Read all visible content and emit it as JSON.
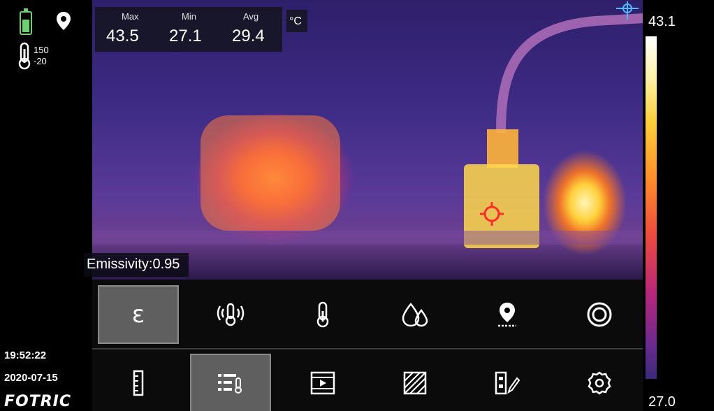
{
  "stats": {
    "max_label": "Max",
    "max_value": "43.5",
    "min_label": "Min",
    "min_value": "27.1",
    "avg_label": "Avg",
    "avg_value": "29.4",
    "unit": "°C"
  },
  "range": {
    "high": "150",
    "low": "-20"
  },
  "emissivity": "Emissivity:0.95",
  "scale": {
    "max": "43.1",
    "min": "27.0"
  },
  "time": "19:52:22",
  "date": "2020-07-15",
  "brand": "FOTRIC",
  "colors": {
    "battery": "#6fd06f",
    "crosshair": "#ff2a2a",
    "selected_bg": "#5f5f5f",
    "spot_marker": "#4fb8ff"
  },
  "toolbar_top": [
    {
      "icon": "epsilon-icon",
      "label": "ε",
      "selected": true
    },
    {
      "icon": "thermometer-signal-icon",
      "selected": false
    },
    {
      "icon": "thermometer-icon",
      "selected": false
    },
    {
      "icon": "water-drops-icon",
      "selected": false
    },
    {
      "icon": "location-pin-icon",
      "selected": false
    },
    {
      "icon": "target-circle-icon",
      "selected": false
    }
  ],
  "toolbar_bottom": [
    {
      "icon": "ruler-icon",
      "selected": false
    },
    {
      "icon": "temperature-list-icon",
      "selected": true
    },
    {
      "icon": "film-play-icon",
      "selected": false
    },
    {
      "icon": "area-hatch-icon",
      "selected": false
    },
    {
      "icon": "palette-edit-icon",
      "selected": false
    },
    {
      "icon": "gear-icon",
      "selected": false
    }
  ]
}
